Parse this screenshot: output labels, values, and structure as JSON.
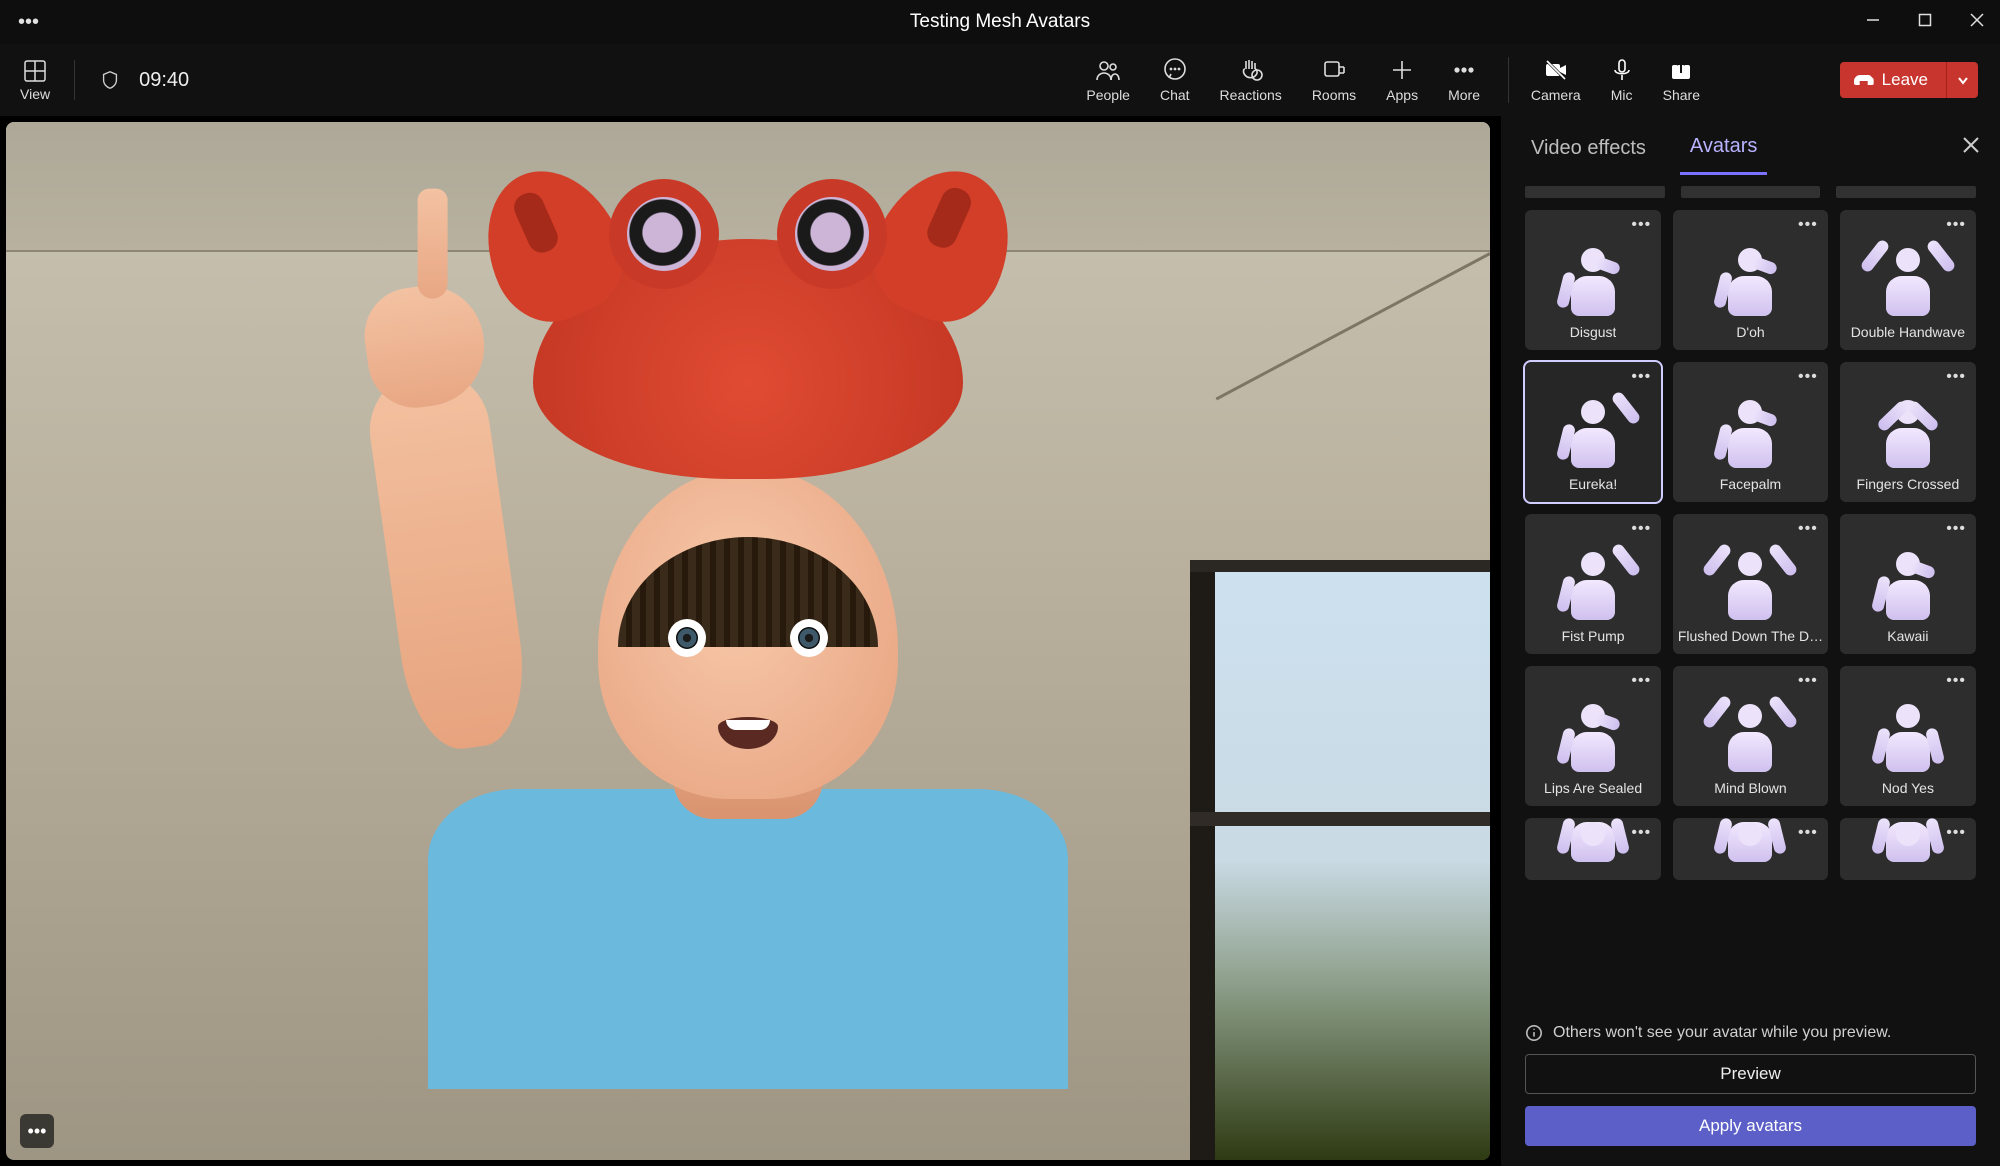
{
  "window": {
    "title": "Testing Mesh Avatars"
  },
  "toolbar": {
    "view_label": "View",
    "clock": "09:40",
    "people": "People",
    "chat": "Chat",
    "reactions": "Reactions",
    "rooms": "Rooms",
    "apps": "Apps",
    "more": "More",
    "camera": "Camera",
    "mic": "Mic",
    "share": "Share",
    "leave": "Leave"
  },
  "panel": {
    "tabs": {
      "effects": "Video effects",
      "avatars": "Avatars",
      "active": "avatars"
    },
    "info": "Others won't see your avatar while you preview.",
    "preview": "Preview",
    "apply": "Apply avatars",
    "reactions": [
      {
        "label": "Disgust",
        "variant": "v-face"
      },
      {
        "label": "D'oh",
        "variant": "v-face"
      },
      {
        "label": "Double Handwave",
        "variant": "v-both"
      },
      {
        "label": "Eureka!",
        "variant": "v-raise",
        "selected": true
      },
      {
        "label": "Facepalm",
        "variant": "v-face"
      },
      {
        "label": "Fingers Crossed",
        "variant": "v-cross"
      },
      {
        "label": "Fist Pump",
        "variant": "v-raise"
      },
      {
        "label": "Flushed Down The Drain",
        "variant": "v-both"
      },
      {
        "label": "Kawaii",
        "variant": "v-face"
      },
      {
        "label": "Lips Are Sealed",
        "variant": "v-face"
      },
      {
        "label": "Mind Blown",
        "variant": "v-both"
      },
      {
        "label": "Nod Yes",
        "variant": ""
      }
    ]
  }
}
